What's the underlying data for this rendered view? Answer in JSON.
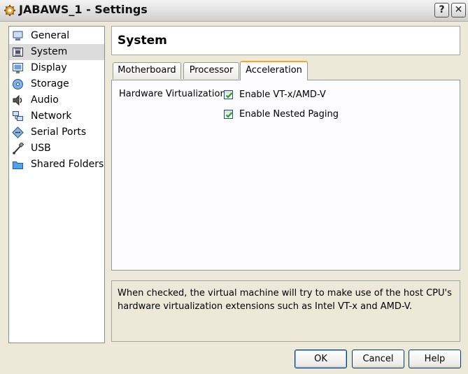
{
  "window": {
    "title": "JABAWS_1 - Settings"
  },
  "titlebar_buttons": {
    "help": "?",
    "close": "✕"
  },
  "sidebar": {
    "selected": "System",
    "items": [
      {
        "label": "General",
        "icon": "monitor-icon"
      },
      {
        "label": "System",
        "icon": "chip-icon"
      },
      {
        "label": "Display",
        "icon": "display-icon"
      },
      {
        "label": "Storage",
        "icon": "disk-icon"
      },
      {
        "label": "Audio",
        "icon": "speaker-icon"
      },
      {
        "label": "Network",
        "icon": "network-icon"
      },
      {
        "label": "Serial Ports",
        "icon": "serial-port-icon"
      },
      {
        "label": "USB",
        "icon": "usb-icon"
      },
      {
        "label": "Shared Folders",
        "icon": "folder-icon"
      }
    ]
  },
  "page": {
    "title": "System"
  },
  "tabs": [
    {
      "label": "Motherboard"
    },
    {
      "label": "Processor"
    },
    {
      "label": "Acceleration"
    }
  ],
  "active_tab": "Acceleration",
  "acceleration": {
    "hw_virt_label": "Hardware Virtualization:",
    "vtx": {
      "label": "Enable VT-x/AMD-V",
      "checked": true
    },
    "nested_paging": {
      "label": "Enable Nested Paging",
      "checked": true
    }
  },
  "description": "When checked, the virtual machine will try to make use of the host CPU's hardware virtualization extensions such as Intel VT-x and AMD-V.",
  "buttons": {
    "ok": "OK",
    "cancel": "Cancel",
    "help": "Help"
  },
  "colors": {
    "active_tab_accent": "#f5a623",
    "check": "#21a121",
    "selection": "#dcdcdc"
  }
}
